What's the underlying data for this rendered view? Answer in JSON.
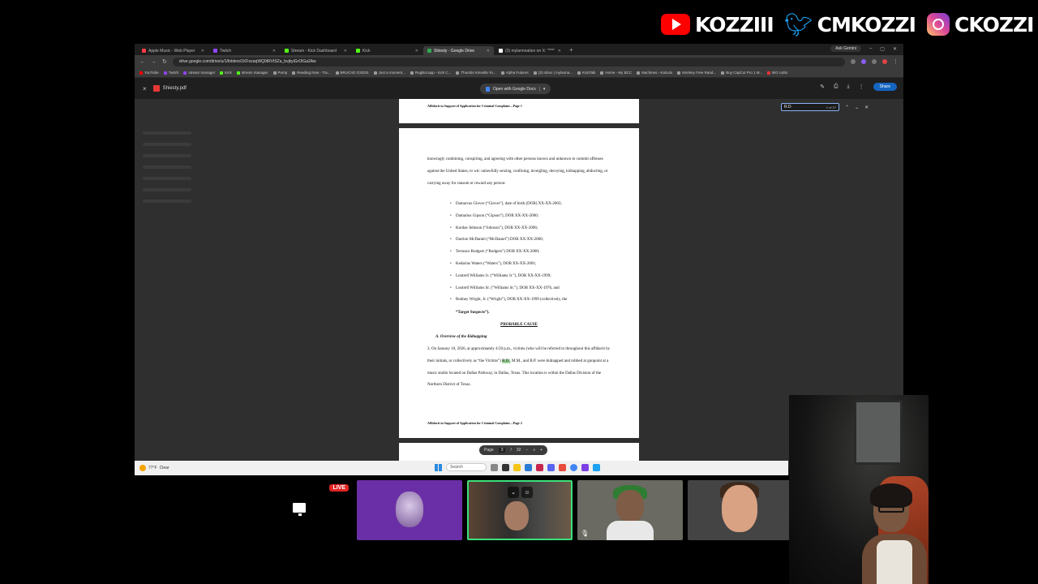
{
  "overlay": {
    "youtube_handle": "KOZZIII",
    "twitter_handle": "CMKOZZI",
    "instagram_handle": "CKOZZI"
  },
  "browser": {
    "tabs": [
      {
        "label": "Apple Music - Web Player",
        "color": "#fc3c44"
      },
      {
        "label": "Twitch",
        "color": "#9146ff"
      },
      {
        "label": "Stream - Kick Dashboard",
        "color": "#53fc18"
      },
      {
        "label": "Kick",
        "color": "#53fc18"
      },
      {
        "label": "Shiesty - Google Drive",
        "color": "#34a853",
        "active": true
      },
      {
        "label": "(3) mylannnation on X: \"***\"",
        "color": "#ffffff"
      }
    ],
    "new_tab": "+",
    "gemini_button": "Ask Gemini",
    "url": "drive.google.com/drive/u/1/folders/1KFozaqWQ0tRVtSZa_bvjkyiGrOlGa2Aw",
    "bookmarks": [
      "YouTube",
      "Twitch",
      "stream manager",
      "Kick",
      "stream manager",
      "Pump",
      "Reading Now - Tra...",
      "BRUCAD G3D3S",
      "Just a moment...",
      "RugBot.app - Kick C...",
      "Thumbs Kinsella Yo...",
      "Alpha Futures",
      "(3) Inbox | mylanna...",
      "KickTalk",
      "Home - My BCC",
      "Machines - Kalculo",
      "Monkey Free Rand...",
      "Buy CapCut Pro 1 M...",
      "BiG rodst"
    ]
  },
  "viewer": {
    "close": "×",
    "file_name": "Shiesty.pdf",
    "open_with": "Open with Google Docs",
    "share": "Share",
    "find_query": "R.D",
    "find_count": "1 of 37"
  },
  "pdf": {
    "page1_footer": "Affidavit in Support of Application for Criminal Complaint—Page 1",
    "intro": "knowingly combining, conspiring, and agreeing with other persons known and unknown to commit offenses against the United States, to wit: unlawfully seizing, confining, inveigling, decoying, kidnapping, abducting, or carrying away for ransom or reward any person:",
    "suspects": [
      "Damarcus Glover (“Glover”), date of birth (DOB) XX-XX-2003;",
      "Damarius Gipson (“Gipson”), DOB XX-XX-2000;",
      "Kordae Johnson (“Johnson”), DOB XX-XX-2006;",
      "Darrion McDaniel (“McDaniel”) DOB XX-XX-2000;",
      "Terrance Rodgers (“Rodgers”) DOB XX-XX-2000;",
      "Kedarius Waters (“Waters”), DOB XX-XX-2001;",
      "Lontrell Williams Jr. (“Williams Jr.”), DOB XX-XX-1999;",
      "Lontrell Williams Sr. (“Williams Sr.”), DOB XX-XX-1976, and",
      "Rodney Wright, Jr. (“Wright”), DOB XX-XX-1999 (collectively, the"
    ],
    "target_suspects": "“Target Suspects”).",
    "probable_cause": "PROBABLE CAUSE",
    "subhead": "A.  Overview of the Kidnapping",
    "para3_a": "3.      On January 10, 2026, at approximately 4:50 p.m., victims (who will be referred to throughout this affidavit by their initials, or collectively as “the Victims”)",
    "para3_hl": "R.D.",
    "para3_b": ", M.M., and B.P. were kidnapped and robbed at gunpoint at a music studio located on Dallas Parkway, in Dallas, Texas. This location is within the Dallas Division of the Northern District of Texas.",
    "page2_footer": "Affidavit in Support of Application for Criminal Complaint—Page 2",
    "page_label": "Page",
    "page_current": "3",
    "page_sep": "/",
    "page_total": "32"
  },
  "taskbar": {
    "weather_temp": "77°F",
    "weather_desc": "Clear",
    "search": "Search"
  },
  "call": {
    "live_badge": "LIVE"
  }
}
